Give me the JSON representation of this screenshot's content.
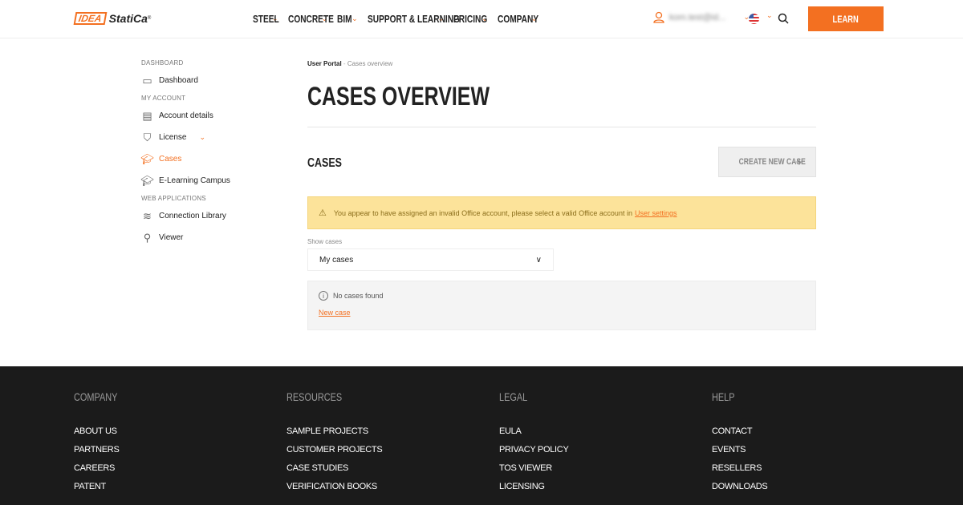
{
  "header": {
    "logo_text": "IDEA StatiCa",
    "nav": [
      "STEEL",
      "CONCRETE",
      "BIM",
      "SUPPORT & LEARNING",
      "PRICING",
      "COMPANY"
    ],
    "user_email": "kom.test@id...",
    "learn_label": "LEARN"
  },
  "sidebar": {
    "sections": [
      {
        "title": "DASHBOARD",
        "items": [
          {
            "label": "Dashboard",
            "icon": "monitor-icon"
          }
        ]
      },
      {
        "title": "MY ACCOUNT",
        "items": [
          {
            "label": "Account details",
            "icon": "document-icon"
          },
          {
            "label": "License",
            "icon": "shield-user-icon"
          },
          {
            "label": "Cases",
            "icon": "mortarboard-icon",
            "active": true
          },
          {
            "label": "E-Learning Campus",
            "icon": "mortarboard-icon"
          }
        ]
      },
      {
        "title": "WEB APPLICATIONS",
        "items": [
          {
            "label": "Connection Library",
            "icon": "layers-icon"
          },
          {
            "label": "Viewer",
            "icon": "search-icon"
          }
        ]
      }
    ]
  },
  "main": {
    "breadcrumb": [
      "User Portal",
      "Cases overview"
    ],
    "title": "CASES OVERVIEW",
    "section_title": "CASES",
    "create_label": "CREATE NEW CASE",
    "alert_text": "You appear to have assigned an invalid Office account, please select a valid Office account in",
    "alert_link": "User settings",
    "show_label": "Show cases",
    "select_value": "My cases",
    "empty_text": "No cases found",
    "new_case": "New case"
  },
  "footer": {
    "columns": [
      {
        "title": "COMPANY",
        "links": [
          "ABOUT US",
          "PARTNERS",
          "CAREERS",
          "PATENT"
        ]
      },
      {
        "title": "RESOURCES",
        "links": [
          "SAMPLE PROJECTS",
          "CUSTOMER PROJECTS",
          "CASE STUDIES",
          "VERIFICATION BOOKS"
        ]
      },
      {
        "title": "LEGAL",
        "links": [
          "EULA",
          "PRIVACY POLICY",
          "TOS VIEWER",
          "LICENSING"
        ]
      },
      {
        "title": "HELP",
        "links": [
          "CONTACT",
          "EVENTS",
          "RESELLERS",
          "DOWNLOADS"
        ]
      }
    ]
  },
  "colors": {
    "accent": "#f37021",
    "alert_bg": "#fce39a",
    "footer_bg": "#1b1b1b"
  }
}
